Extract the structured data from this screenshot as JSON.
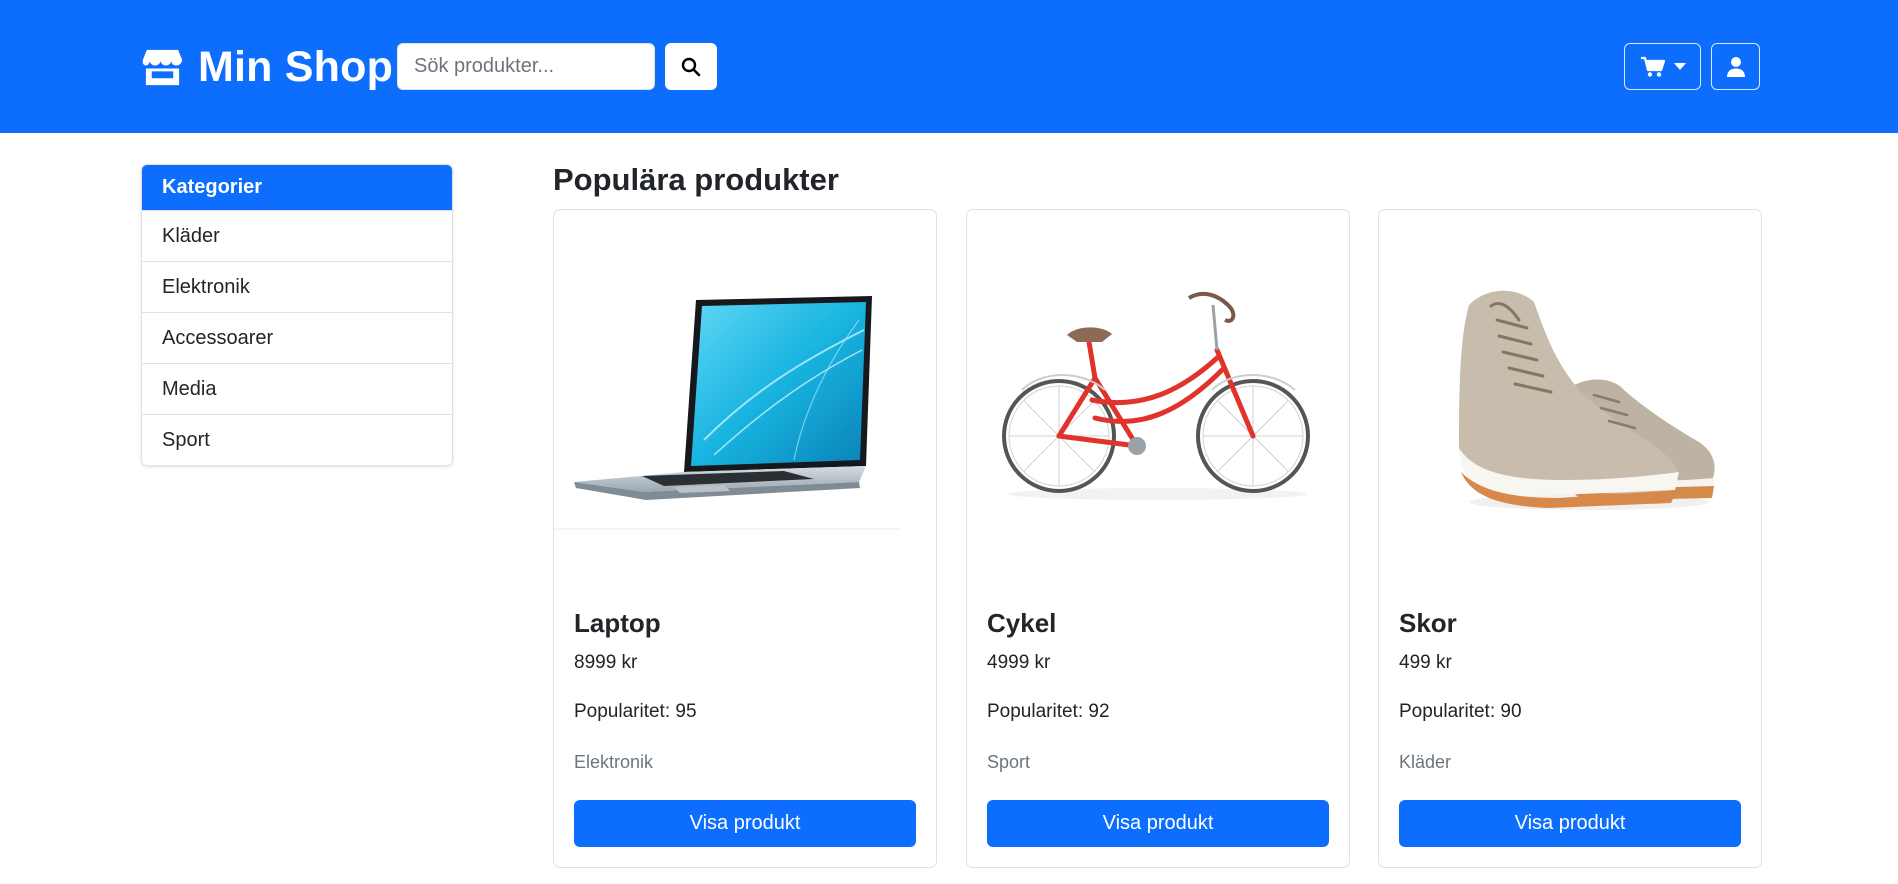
{
  "colors": {
    "primary": "#0d6efd",
    "muted": "#6c757d",
    "text": "#212529",
    "border": "#dee2e6"
  },
  "header": {
    "brand": "Min Shop",
    "brand_icon": "store-icon",
    "search_placeholder": "Sök produkter...",
    "search_icon": "search-icon",
    "cart_icon": "cart-icon",
    "user_icon": "user-icon"
  },
  "sidebar": {
    "title": "Kategorier",
    "items": [
      {
        "label": "Kläder"
      },
      {
        "label": "Elektronik"
      },
      {
        "label": "Accessoarer"
      },
      {
        "label": "Media"
      },
      {
        "label": "Sport"
      }
    ]
  },
  "main": {
    "title": "Populära produkter",
    "products": [
      {
        "name": "Laptop",
        "price": "8999 kr",
        "popularity": "Popularitet: 95",
        "category": "Elektronik",
        "button": "Visa produkt",
        "image": "laptop-image"
      },
      {
        "name": "Cykel",
        "price": "4999 kr",
        "popularity": "Popularitet: 92",
        "category": "Sport",
        "button": "Visa produkt",
        "image": "bicycle-image"
      },
      {
        "name": "Skor",
        "price": "499 kr",
        "popularity": "Popularitet: 90",
        "category": "Kläder",
        "button": "Visa produkt",
        "image": "shoes-image"
      }
    ]
  }
}
